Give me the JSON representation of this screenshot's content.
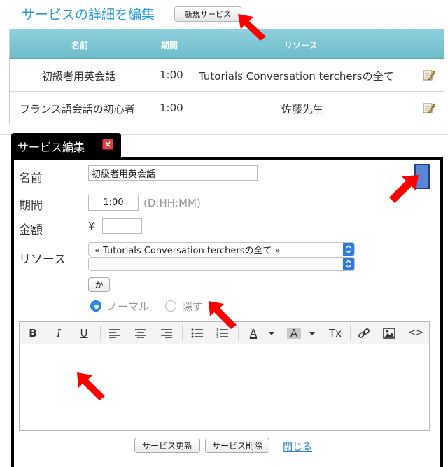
{
  "header": {
    "title": "サービスの詳細を編集",
    "new_service_button": "新規サービス"
  },
  "table": {
    "columns": [
      "名前",
      "期間",
      "リソース"
    ],
    "rows": [
      {
        "name": "初級者用英会話",
        "duration": "1:00",
        "resource": "Tutorials Conversation terchersの全て",
        "edit_icon": "edit-icon"
      },
      {
        "name": "フランス語会話の初心者",
        "duration": "1:00",
        "resource": "佐藤先生",
        "edit_icon": "edit-icon"
      }
    ]
  },
  "dialog": {
    "title": "サービス編集",
    "close_icon": "close-icon",
    "name_label": "名前",
    "name_value": "初級者用英会話",
    "duration_label": "期間",
    "duration_value": "1:00",
    "duration_hint": "(D:HH:MM)",
    "price_label": "金額",
    "price_symbol": "¥",
    "price_value": "",
    "resource_label": "リソース",
    "resource_select_1": "« Tutorials Conversation terchersの全て »",
    "resource_select_2": "",
    "or_button": "か",
    "visibility": {
      "normal": "ノーマル",
      "hidden": "隠す",
      "selected": "normal"
    },
    "color_swatch": "#5a84d4",
    "toolbar": [
      "bold-icon",
      "italic-icon",
      "underline-icon",
      "align-left-icon",
      "align-center-icon",
      "align-right-icon",
      "bullet-list-icon",
      "numbered-list-icon",
      "text-color-icon",
      "background-color-icon",
      "clear-format-icon",
      "link-icon",
      "image-icon",
      "code-view-icon"
    ],
    "toolbar_labels": {
      "bold": "B",
      "italic": "I",
      "underline": "U",
      "text_color": "A",
      "bg_color": "A",
      "clear_format": "Tx",
      "code": "<>"
    },
    "editor_content": "",
    "update_button": "サービス更新",
    "delete_button": "サービス削除",
    "close_link": "閉じる"
  },
  "annotation_color": "#ff0000"
}
